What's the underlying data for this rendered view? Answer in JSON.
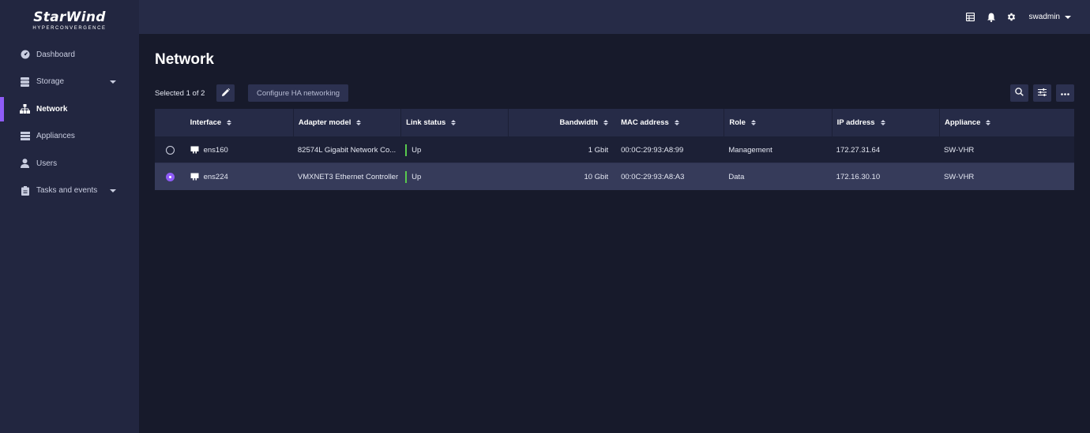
{
  "brand": {
    "name": "StarWind",
    "tagline": "HYPERCONVERGENCE"
  },
  "sidebar": {
    "items": [
      {
        "label": "Dashboard",
        "icon": "dashboard-icon"
      },
      {
        "label": "Storage",
        "icon": "storage-icon",
        "expandable": true
      },
      {
        "label": "Network",
        "icon": "network-icon",
        "active": true
      },
      {
        "label": "Appliances",
        "icon": "appliances-icon"
      },
      {
        "label": "Users",
        "icon": "user-icon"
      },
      {
        "label": "Tasks and events",
        "icon": "tasks-icon",
        "expandable": true
      }
    ]
  },
  "topbar": {
    "username": "swadmin",
    "icons": [
      "table-icon",
      "bell-icon",
      "gear-icon"
    ]
  },
  "page": {
    "title": "Network"
  },
  "toolbar": {
    "selected_text": "Selected 1 of 2",
    "configure_label": "Configure HA networking"
  },
  "table": {
    "columns": [
      "Interface",
      "Adapter model",
      "Link status",
      "Bandwidth",
      "MAC address",
      "Role",
      "IP address",
      "Appliance"
    ],
    "rows": [
      {
        "selected": false,
        "interface": "ens160",
        "adapter": "82574L Gigabit Network Co...",
        "link_status": "Up",
        "bandwidth": "1 Gbit",
        "mac": "00:0C:29:93:A8:99",
        "role": "Management",
        "ip": "172.27.31.64",
        "appliance": "SW-VHR"
      },
      {
        "selected": true,
        "interface": "ens224",
        "adapter": "VMXNET3 Ethernet Controller",
        "link_status": "Up",
        "bandwidth": "10 Gbit",
        "mac": "00:0C:29:93:A8:A3",
        "role": "Data",
        "ip": "172.16.30.10",
        "appliance": "SW-VHR"
      }
    ]
  },
  "colors": {
    "accent": "#8f5cf7",
    "status_up": "#58c94e",
    "sidebar_bg": "#222640",
    "main_bg": "#171a2b"
  }
}
